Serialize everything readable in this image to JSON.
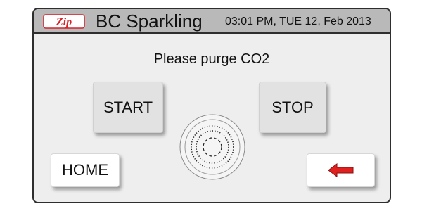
{
  "header": {
    "brand": "Zip",
    "title": "BC Sparkling",
    "datetime": "03:01 PM, TUE 12, Feb 2013"
  },
  "main": {
    "message": "Please purge CO2",
    "start_label": "START",
    "stop_label": "STOP",
    "home_label": "HOME",
    "back_icon": "left-arrow-icon",
    "dial_icon": "purge-status-rings-icon"
  },
  "colors": {
    "brand_red": "#d8232a",
    "header_bg": "#b9b9b9",
    "panel_bg": "#eeeeee",
    "arrow_red": "#e0201e"
  }
}
